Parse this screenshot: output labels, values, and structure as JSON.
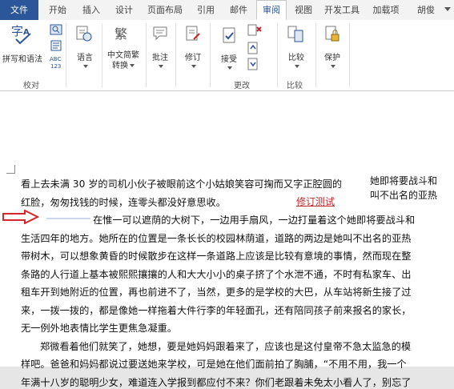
{
  "tabs": [
    "文件",
    "开始",
    "插入",
    "设计",
    "页面布局",
    "引用",
    "邮件",
    "审阅",
    "视图",
    "开发工具",
    "加载项",
    "胡俊"
  ],
  "ribbon": {
    "spelling": "拼写和语法",
    "proofing_group": "校对",
    "language": "语言",
    "chinese_conversion_line1": "中文简繁",
    "chinese_conversion_line2": "转换",
    "comment": "批注",
    "track_changes": "修订",
    "accept": "接受",
    "changes_group": "更改",
    "compare": "比较",
    "compare_group": "比较",
    "protect": "保护"
  },
  "document": {
    "lines": [
      "看上去未满 30 岁的司机小伙子被眼前这个小姑娘笑容可掬而又字正腔圆的",
      "红脸，匆匆找钱的时候，连零头都没好意思收。",
      "在惟一可以遮荫的大树下，一边用手扇风，一边打量着这个她即将要战斗和",
      "生活四年的地方。她所在的位置是一条长长的校园林荫道，道路的两边是她叫不出名的亚热",
      "带树木，可以想象黄昏的时候散步在这样一条道路上应该是比较有意境的事情，然而现在整",
      "条路的人行道上基本被熙熙攘攘的人和大大小小的桌子挤了个水泄不通，不时有私家车、出",
      "租车开到她附近的位置，再也前进不了，当然，更多的是学校的大巴，从车站将新生接了过",
      "来，一拨一拨的，都是像她一样拖着大件行李的年轻面孔，还有陪同孩子前来报名的家长，",
      "无一例外地表情比学生更焦急凝重。",
      "郑微看着他们就笑了，她想，要是她妈妈跟着来了，应该也是这付皇帝不急太监急的模",
      "样吧。爸爸和妈妈都说过要送她来学校，可是她在他们面前拍了胸脯，“不用不用，我一个",
      "年满十八岁的聪明少女，难道连入学报到都应付不来？你们老跟着未免太小看人了，别忘了"
    ],
    "revision_label": "修订测试",
    "balloon_line1": "她即将要战斗和",
    "balloon_line2": "叫不出名的亚热"
  }
}
